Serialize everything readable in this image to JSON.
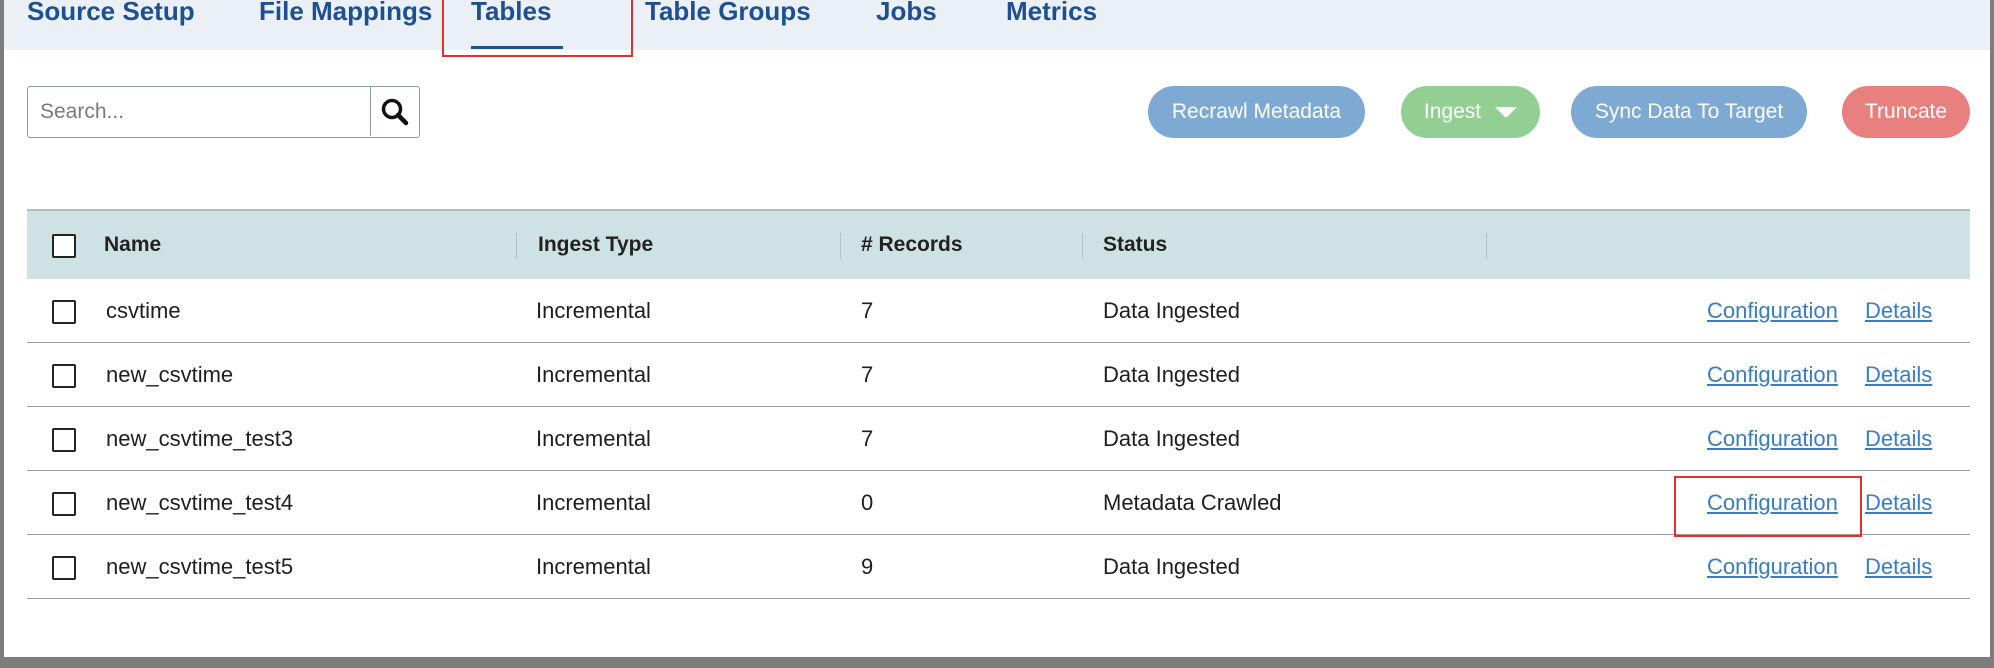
{
  "tabs": [
    {
      "label": "Source Setup"
    },
    {
      "label": "File Mappings"
    },
    {
      "label": "Tables",
      "active": true
    },
    {
      "label": "Table Groups"
    },
    {
      "label": "Jobs"
    },
    {
      "label": "Metrics"
    }
  ],
  "search": {
    "placeholder": "Search...",
    "value": "",
    "icon": "search-icon"
  },
  "actions": {
    "recrawl": "Recrawl Metadata",
    "ingest": "Ingest",
    "sync": "Sync Data To Target",
    "truncate": "Truncate"
  },
  "colors": {
    "accent": "#1e4f91",
    "recrawl": "#7ea9d3",
    "ingest": "#93cf93",
    "sync": "#7ea9d3",
    "truncate": "#e98080",
    "link": "#3a7bc8",
    "header_bg": "#cfe2e3",
    "highlight": "#e0312d"
  },
  "table": {
    "columns": [
      "Name",
      "Ingest Type",
      "# Records",
      "Status"
    ],
    "rows": [
      {
        "name": "csvtime",
        "ingest_type": "Incremental",
        "records": "7",
        "status": "Data Ingested",
        "config_link": "Configuration",
        "details_link": "Details"
      },
      {
        "name": "new_csvtime",
        "ingest_type": "Incremental",
        "records": "7",
        "status": "Data Ingested",
        "config_link": "Configuration",
        "details_link": "Details"
      },
      {
        "name": "new_csvtime_test3",
        "ingest_type": "Incremental",
        "records": "7",
        "status": "Data Ingested",
        "config_link": "Configuration",
        "details_link": "Details"
      },
      {
        "name": "new_csvtime_test4",
        "ingest_type": "Incremental",
        "records": "0",
        "status": "Metadata Crawled",
        "config_link": "Configuration",
        "details_link": "Details"
      },
      {
        "name": "new_csvtime_test5",
        "ingest_type": "Incremental",
        "records": "9",
        "status": "Data Ingested",
        "config_link": "Configuration",
        "details_link": "Details"
      }
    ]
  }
}
